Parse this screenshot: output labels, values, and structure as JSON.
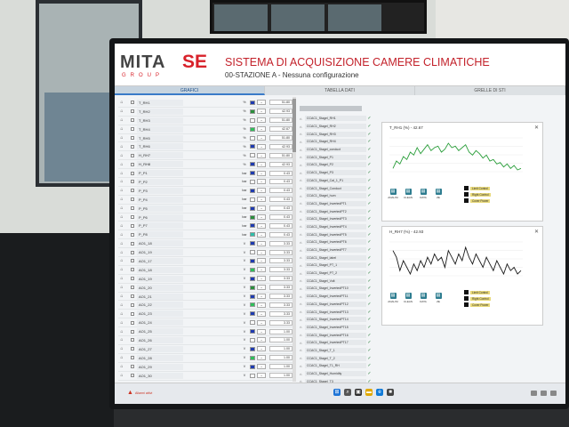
{
  "header": {
    "logo_mita": "MITA",
    "logo_se": "SE",
    "logo_group": "GROUP",
    "title": "SISTEMA DI ACQUISIZIONE CAMERE CLIMATICHE",
    "subtitle": "00-STAZIONE A - Nessuna configurazione"
  },
  "tabs": [
    "GRAFICI",
    "TABELLA DATI",
    "GRELLE DI STI"
  ],
  "rows": [
    {
      "label": "T_RH1",
      "unit": "%",
      "color": "#1f3bb0",
      "value": "51.80"
    },
    {
      "label": "T_RH2",
      "unit": "%",
      "color": "#2a8f3c",
      "value": "42.93"
    },
    {
      "label": "T_RH3",
      "unit": "%",
      "color": "#ffffff",
      "value": "51.80"
    },
    {
      "label": "T_RH4",
      "unit": "%",
      "color": "#2fbf5a",
      "value": "42.67"
    },
    {
      "label": "T_RH5",
      "unit": "%",
      "color": "#ffffff",
      "value": "51.80"
    },
    {
      "label": "T_RH6",
      "unit": "%",
      "color": "#1f3bb0",
      "value": "42.93"
    },
    {
      "label": "H_RH7",
      "unit": "%",
      "color": "#ffffff",
      "value": "51.80"
    },
    {
      "label": "H_RH8",
      "unit": "%",
      "color": "#1f3bb0",
      "value": "42.93"
    },
    {
      "label": "P_P1",
      "unit": "bar",
      "color": "#1f3bb0",
      "value": "0.43"
    },
    {
      "label": "P_P2",
      "unit": "bar",
      "color": "#ffffff",
      "value": "0.43"
    },
    {
      "label": "P_P3",
      "unit": "bar",
      "color": "#1f3bb0",
      "value": "0.43"
    },
    {
      "label": "P_P4",
      "unit": "bar",
      "color": "#ffffff",
      "value": "0.43"
    },
    {
      "label": "P_P5",
      "unit": "bar",
      "color": "#1f3bb0",
      "value": "0.43"
    },
    {
      "label": "P_P6",
      "unit": "bar",
      "color": "#2a8f3c",
      "value": "0.43"
    },
    {
      "label": "P_P7",
      "unit": "bar",
      "color": "#1f3bb0",
      "value": "0.43"
    },
    {
      "label": "P_P8",
      "unit": "bar",
      "color": "#2fbfaa",
      "value": "0.43"
    },
    {
      "label": "AO1_18",
      "unit": "V",
      "color": "#1f3bb0",
      "value": "3.33"
    },
    {
      "label": "AO1_19",
      "unit": "V",
      "color": "#ffffff",
      "value": "3.33"
    },
    {
      "label": "AO1_17",
      "unit": "V",
      "color": "#1f3bb0",
      "value": "3.33"
    },
    {
      "label": "AO1_18",
      "unit": "V",
      "color": "#2fbf5a",
      "value": "3.33"
    },
    {
      "label": "AO1_19",
      "unit": "V",
      "color": "#1f3bb0",
      "value": "3.33"
    },
    {
      "label": "AO1_20",
      "unit": "V",
      "color": "#2a8f3c",
      "value": "3.33"
    },
    {
      "label": "AO1_21",
      "unit": "V",
      "color": "#1f3bb0",
      "value": "3.33"
    },
    {
      "label": "AO1_22",
      "unit": "V",
      "color": "#2fbf5a",
      "value": "3.33"
    },
    {
      "label": "AO1_23",
      "unit": "V",
      "color": "#1f3bb0",
      "value": "3.33"
    },
    {
      "label": "AO1_24",
      "unit": "V",
      "color": "#ffffff",
      "value": "3.33"
    },
    {
      "label": "AO1_25",
      "unit": "V",
      "color": "#1f3bb0",
      "value": "1.00"
    },
    {
      "label": "AO1_26",
      "unit": "V",
      "color": "#ffffff",
      "value": "1.00"
    },
    {
      "label": "AO1_27",
      "unit": "V",
      "color": "#1f3bb0",
      "value": "1.00"
    },
    {
      "label": "AO1_28",
      "unit": "V",
      "color": "#2fbf5a",
      "value": "1.00"
    },
    {
      "label": "AO1_29",
      "unit": "V",
      "color": "#1f3bb0",
      "value": "1.00"
    },
    {
      "label": "AO1_30",
      "unit": "V",
      "color": "#ffffff",
      "value": "1.00"
    }
  ],
  "mid_items": [
    "CCAC1_Stagel_RH1",
    "CCAC1_Stagel_RH2",
    "CCAC1_Stagel_RH3",
    "CCAC1_Stagel_RH4",
    "CCAC1_Stagel_conduct",
    "CCAC1_Stagel_P1",
    "CCAC1_Stagel_P2",
    "CCAC1_Stagel_P3",
    "CCAC1_Stagel_Cal_1_P1",
    "CCAC1_Stagel_Conduct",
    "CCAC1_Stagel_hum",
    "CCAC1_Stagel_InvertedPT1",
    "CCAC1_Stagel_InvertedPT2",
    "CCAC1_Stagel_InvertedPT3",
    "CCAC1_Stagel_InvertedPT4",
    "CCAC1_Stagel_InvertedPT5",
    "CCAC1_Stagel_InvertedPT6",
    "CCAC1_Stagel_InvertedPT7",
    "CCAC1_Stagel_label",
    "CCAC1_Stagel_PT_1",
    "CCAC1_Stagel_PT_2",
    "CCAC1_Stagel_Volt",
    "CCAC1_Stagel_InvertedPT10",
    "CCAC1_Stagel_InvertedPT11",
    "CCAC1_Stagel_InvertedPT12",
    "CCAC1_Stagel_InvertedPT13",
    "CCAC1_Stagel_InvertedPT14",
    "CCAC1_Stagel_InvertedPT15",
    "CCAC1_Stagel_InvertedPT16",
    "CCAC1_Stagel_InvertedPT17",
    "CCAC1_Stagel_T_1",
    "CCAC1_Stagel_T_2",
    "CCAC1_Stagel_T1_RH",
    "CCAC1_Stagel_Humidity",
    "CCAC1_Stagel_T3",
    "CCAC1_Stagel_Throttled"
  ],
  "charts": [
    {
      "title": "T_RH1 (%) - 42.67",
      "values": [
        41.5,
        42.0,
        41.8,
        42.3,
        42.1,
        42.6,
        42.4,
        42.9,
        42.5,
        42.8,
        43.1,
        42.7,
        42.9,
        43.0,
        42.6,
        42.8,
        43.2,
        42.9,
        43.0,
        42.7,
        42.9,
        43.1,
        42.6,
        42.4,
        42.7,
        42.5,
        42.2,
        42.4,
        42.0,
        42.1,
        41.8,
        41.9,
        41.6,
        41.8,
        41.5,
        41.7,
        41.4,
        41.5
      ],
      "color": "#2a9e3a",
      "legend": [
        "Limit Control",
        "Right Control",
        "Cover Power"
      ]
    },
    {
      "title": "H_RH7 (%) - 42.93",
      "values": [
        43.2,
        43.0,
        42.6,
        42.9,
        42.7,
        42.5,
        42.8,
        42.6,
        42.9,
        42.7,
        43.0,
        42.8,
        43.1,
        42.9,
        43.0,
        42.7,
        43.2,
        43.0,
        42.8,
        43.1,
        42.9,
        43.3,
        43.0,
        42.8,
        43.1,
        42.9,
        42.7,
        43.0,
        42.8,
        42.6,
        42.9,
        42.7,
        42.5,
        42.8,
        42.6,
        42.7,
        42.5,
        42.6
      ],
      "color": "#1a1a1a",
      "legend": [
        "Limit Control",
        "Right Control",
        "Cover Power"
      ]
    }
  ],
  "tools": [
    "ANALISI",
    "CLEAN",
    "DATA",
    "ZE"
  ],
  "footer": {
    "warning": "Allarmi attivi"
  }
}
